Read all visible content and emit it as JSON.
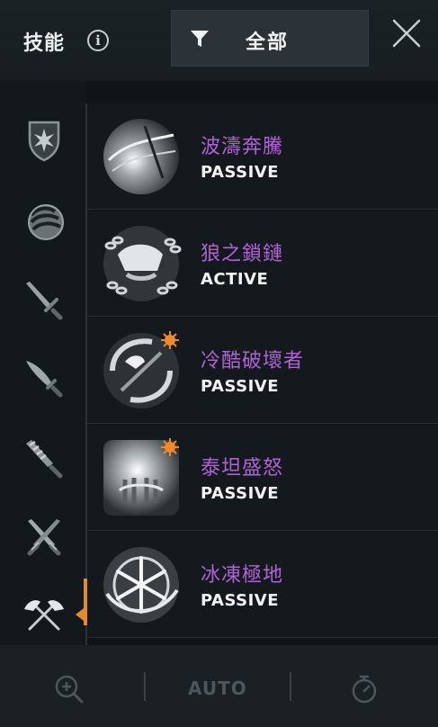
{
  "header": {
    "title": "技能",
    "info_icon": "info-icon",
    "filter_label": "全部",
    "filter_icon": "funnel-icon",
    "close_icon": "close-icon"
  },
  "side_categories": [
    {
      "icon": "shield-star-icon"
    },
    {
      "icon": "fist-icon"
    },
    {
      "icon": "sword-icon"
    },
    {
      "icon": "blade-icon"
    },
    {
      "icon": "spiked-club-icon"
    },
    {
      "icon": "crossed-swords-icon"
    },
    {
      "icon": "crossed-axes-icon",
      "selected": true
    }
  ],
  "skills": [
    {
      "name": "波濤奔騰",
      "type": "PASSIVE",
      "icon": "wave-surge-skill-icon"
    },
    {
      "name": "狼之鎖鏈",
      "type": "ACTIVE",
      "icon": "wolf-chains-skill-icon"
    },
    {
      "name": "冷酷破壞者",
      "type": "PASSIVE",
      "icon": "ruthless-destroyer-skill-icon"
    },
    {
      "name": "泰坦盛怒",
      "type": "PASSIVE",
      "icon": "titan-rage-skill-icon"
    },
    {
      "name": "冰凍極地",
      "type": "PASSIVE",
      "icon": "frozen-polar-skill-icon"
    }
  ],
  "toolbar": {
    "zoom_icon": "zoom-in-icon",
    "auto_label": "AUTO",
    "timer_icon": "stopwatch-icon"
  },
  "colors": {
    "accent": "#e48a2e",
    "skill_name": "#b062d6",
    "background": "#0f1418"
  }
}
